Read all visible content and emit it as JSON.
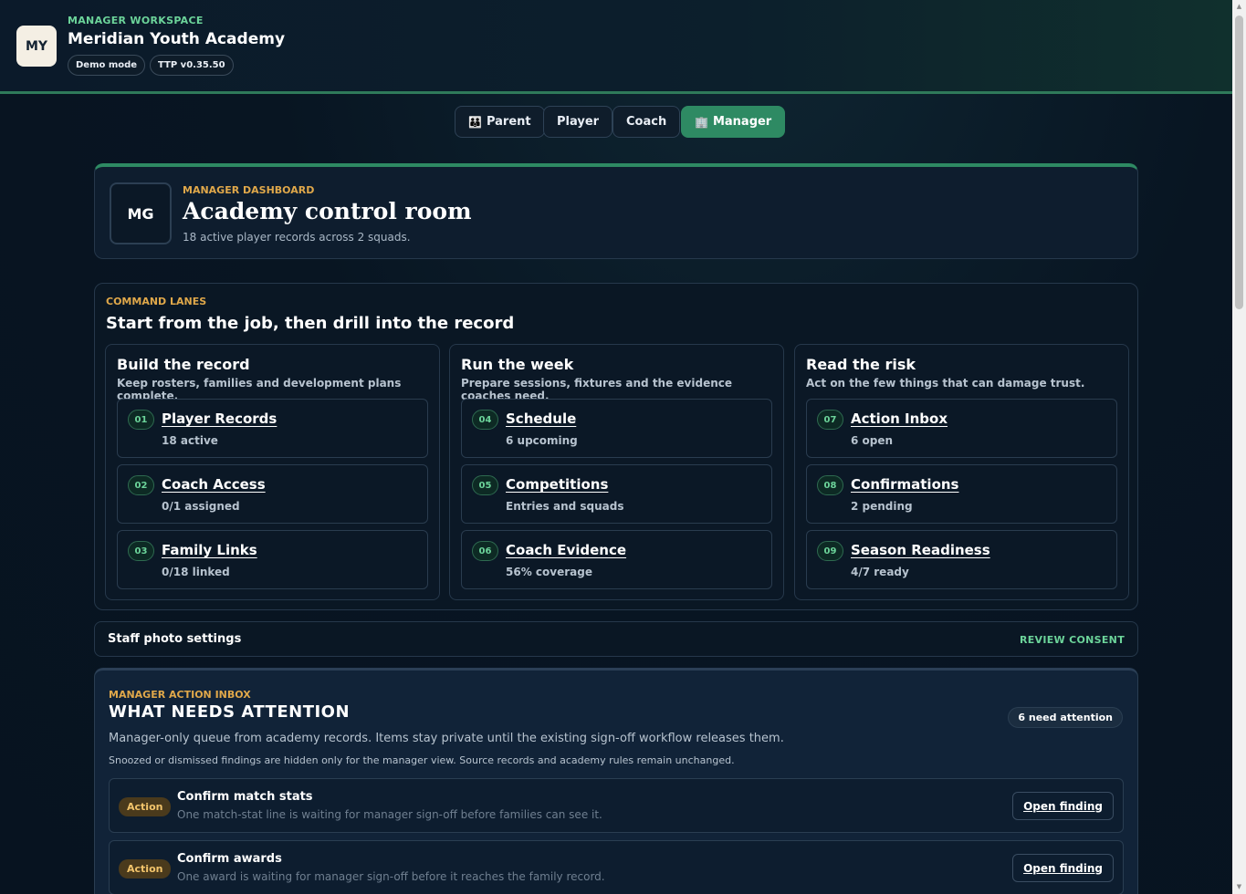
{
  "header": {
    "logo_initials": "MY",
    "workspace_label": "MANAGER WORKSPACE",
    "title": "Meridian Youth Academy",
    "pills": [
      "Demo mode",
      "TTP v0.35.50"
    ]
  },
  "roles": [
    {
      "label": "Parent",
      "icon": "family-icon",
      "active": false
    },
    {
      "label": "Player",
      "active": false
    },
    {
      "label": "Coach",
      "active": false
    },
    {
      "label": "Manager",
      "icon": "building-icon",
      "active": true
    }
  ],
  "dashboard": {
    "badge": "MG",
    "eyebrow": "MANAGER DASHBOARD",
    "title": "Academy control room",
    "subtitle": "18 active player records across 2 squads."
  },
  "lanes": {
    "eyebrow": "COMMAND LANES",
    "title": "Start from the job, then drill into the record",
    "columns": [
      {
        "title": "Build the record",
        "subtitle": "Keep rosters, families and development plans complete.",
        "items": [
          {
            "num": "01",
            "title": "Player Records",
            "meta": "18 active"
          },
          {
            "num": "02",
            "title": "Coach Access",
            "meta": "0/1 assigned"
          },
          {
            "num": "03",
            "title": "Family Links",
            "meta": "0/18 linked"
          }
        ]
      },
      {
        "title": "Run the week",
        "subtitle": "Prepare sessions, fixtures and the evidence coaches need.",
        "items": [
          {
            "num": "04",
            "title": "Schedule",
            "meta": "6 upcoming"
          },
          {
            "num": "05",
            "title": "Competitions",
            "meta": "Entries and squads"
          },
          {
            "num": "06",
            "title": "Coach Evidence",
            "meta": "56% coverage"
          }
        ]
      },
      {
        "title": "Read the risk",
        "subtitle": "Act on the few things that can damage trust.",
        "items": [
          {
            "num": "07",
            "title": "Action Inbox",
            "meta": "6 open"
          },
          {
            "num": "08",
            "title": "Confirmations",
            "meta": "2 pending"
          },
          {
            "num": "09",
            "title": "Season Readiness",
            "meta": "4/7 ready"
          }
        ]
      }
    ]
  },
  "staff_photo": {
    "title": "Staff photo settings",
    "action": "REVIEW CONSENT"
  },
  "inbox": {
    "eyebrow": "MANAGER ACTION INBOX",
    "title": "WHAT NEEDS ATTENTION",
    "badge": "6 need attention",
    "description": "Manager-only queue from academy records. Items stay private until the existing sign-off workflow releases them.",
    "note": "Snoozed or dismissed findings are hidden only for the manager view. Source records and academy rules remain unchanged.",
    "findings": [
      {
        "tag": "Action",
        "title": "Confirm match stats",
        "desc": "One match-stat line is waiting for manager sign-off before families can see it.",
        "button": "Open finding"
      },
      {
        "tag": "Action",
        "title": "Confirm awards",
        "desc": "One award is waiting for manager sign-off before it reaches the family record.",
        "button": "Open finding"
      }
    ]
  },
  "colors": {
    "accent": "#2e8a63",
    "eyebrow": "#e0a84a",
    "success": "#6cd49a",
    "background": "#081522"
  }
}
